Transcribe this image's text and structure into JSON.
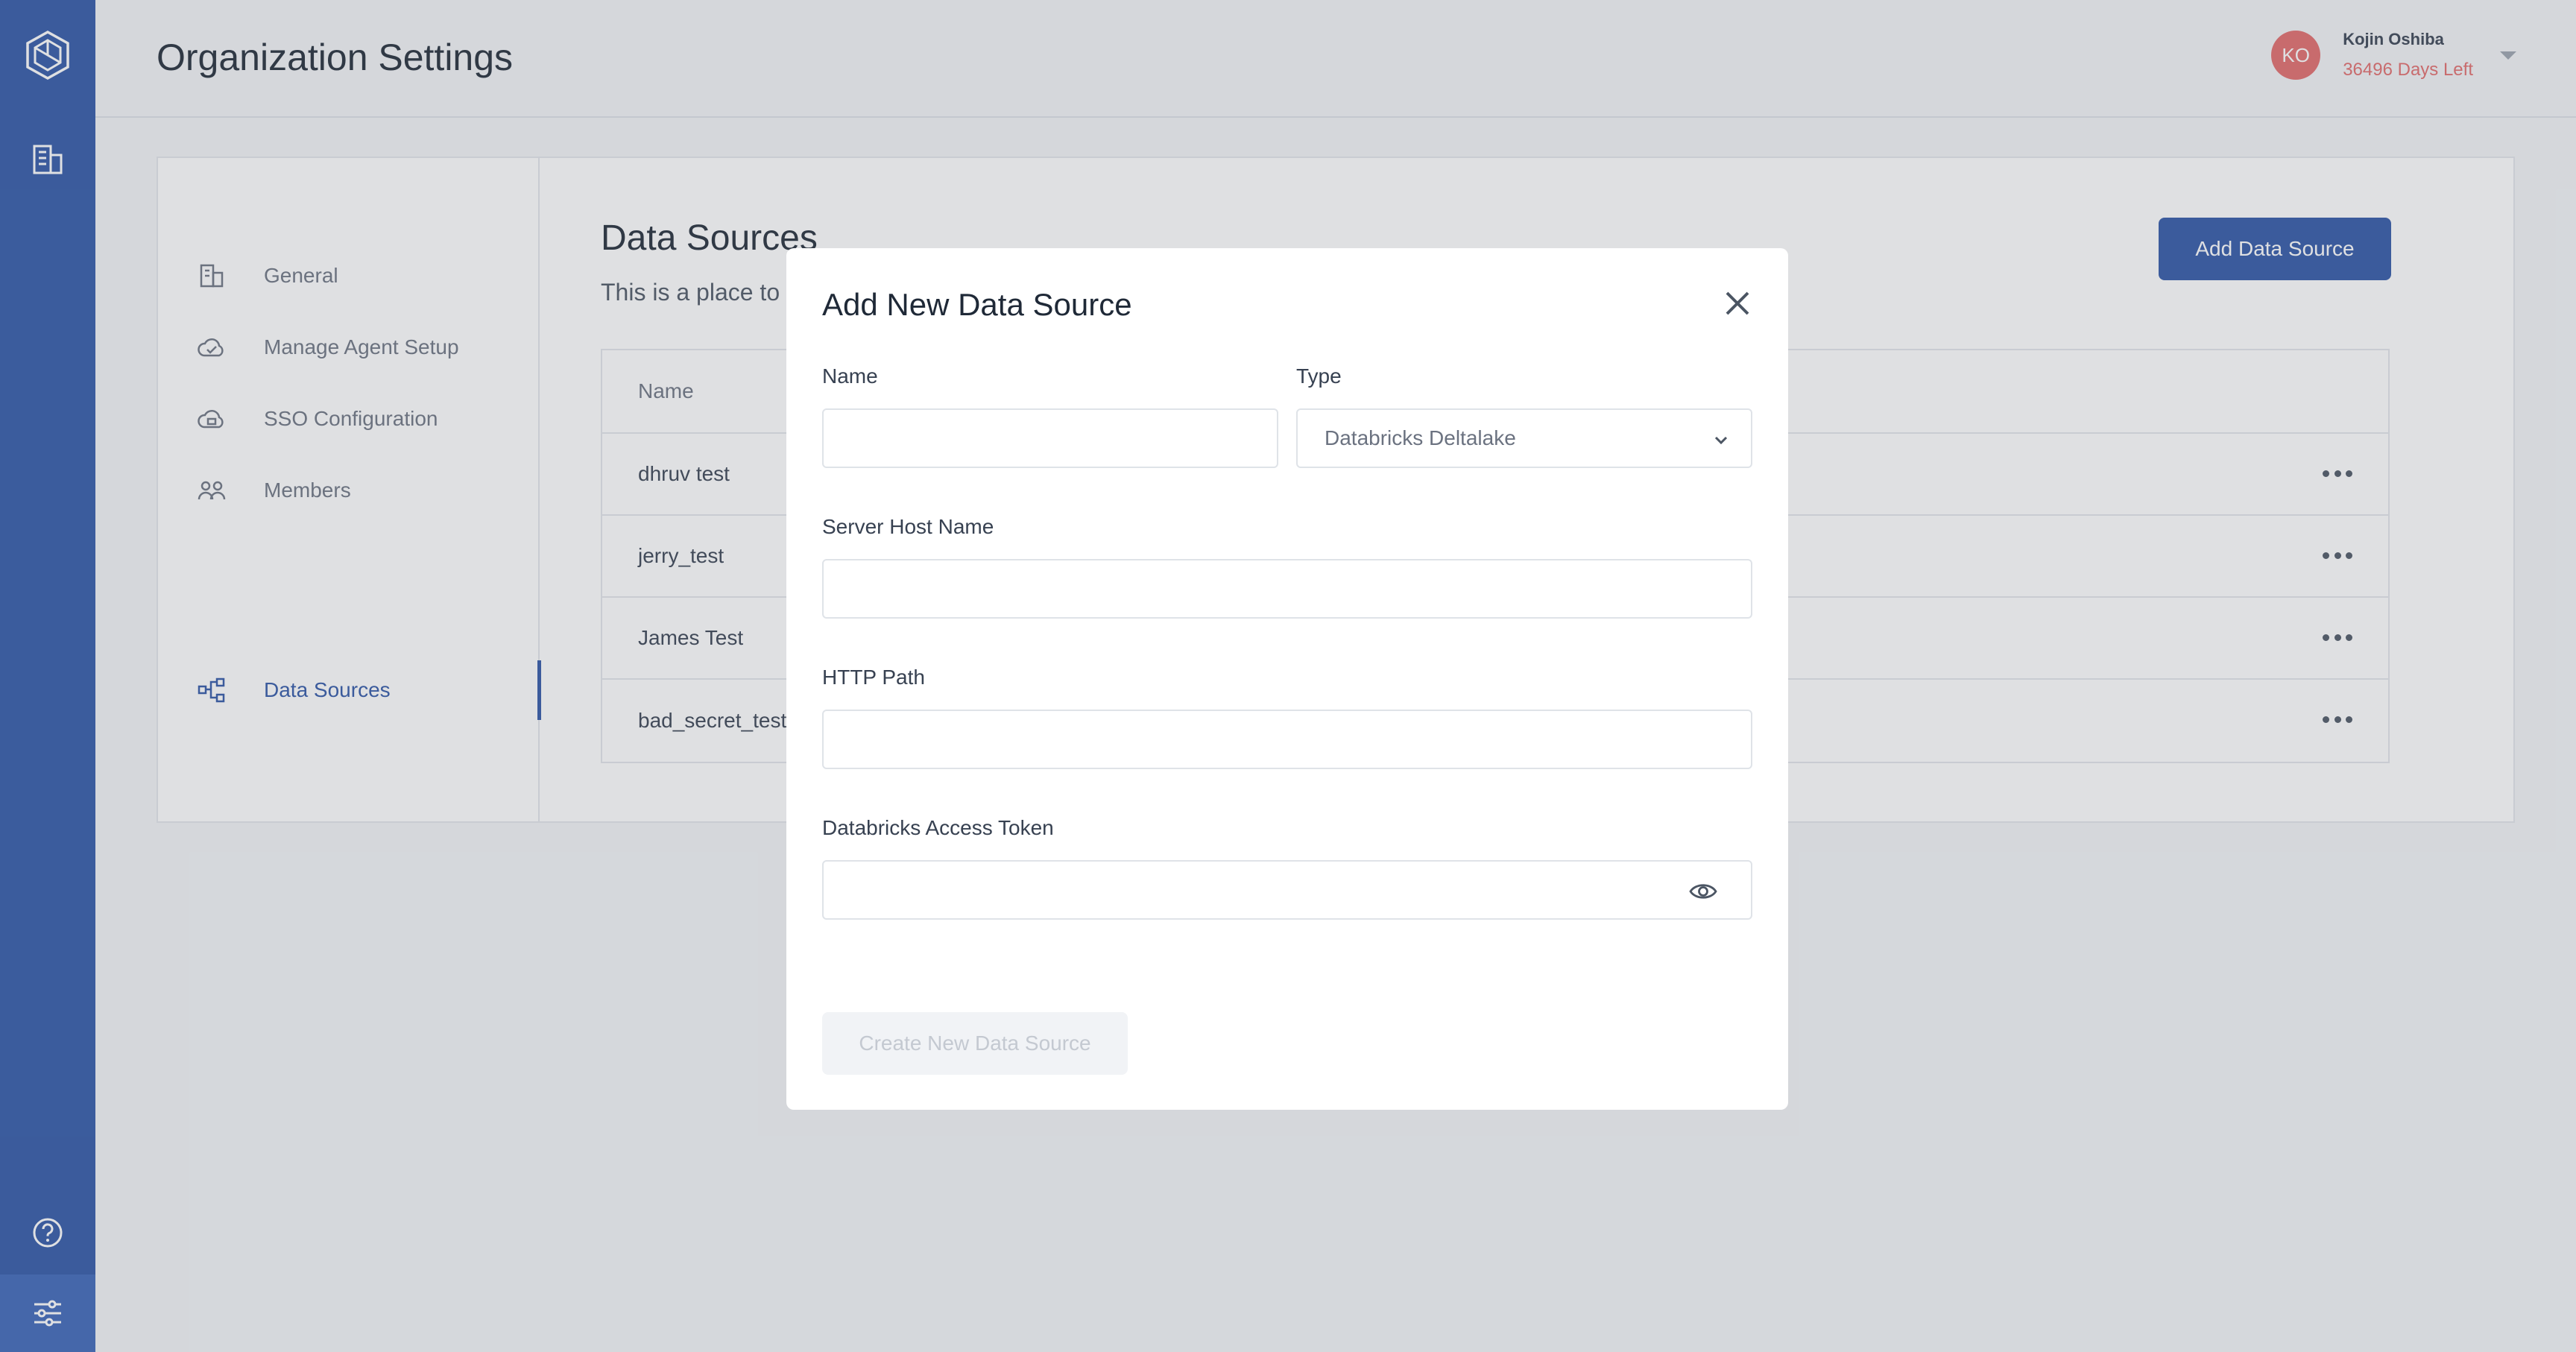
{
  "header": {
    "title": "Organization Settings",
    "user": {
      "initials": "KO",
      "name": "Kojin Oshiba",
      "days_left": "36496 Days Left"
    }
  },
  "sidebar": {
    "items": [
      {
        "label": "General",
        "icon": "building-icon"
      },
      {
        "label": "Manage Agent Setup",
        "icon": "cloud-check-icon"
      },
      {
        "label": "SSO Configuration",
        "icon": "cloud-lock-icon"
      },
      {
        "label": "Members",
        "icon": "users-icon"
      },
      {
        "label": "Data Sources",
        "icon": "data-flow-icon",
        "active": true
      }
    ]
  },
  "main": {
    "title": "Data Sources",
    "subtitle": "This is a place to c",
    "add_button": "Add Data Source",
    "table": {
      "header": "Name",
      "rows": [
        "dhruv test",
        "jerry_test",
        "James Test",
        "bad_secret_test"
      ]
    }
  },
  "modal": {
    "title": "Add New Data Source",
    "fields": {
      "name_label": "Name",
      "type_label": "Type",
      "type_value": "Databricks Deltalake",
      "host_label": "Server Host Name",
      "path_label": "HTTP Path",
      "token_label": "Databricks Access Token"
    },
    "submit": "Create New Data Source"
  },
  "colors": {
    "accent": "#2d55a6",
    "avatar": "#e26a6a"
  }
}
